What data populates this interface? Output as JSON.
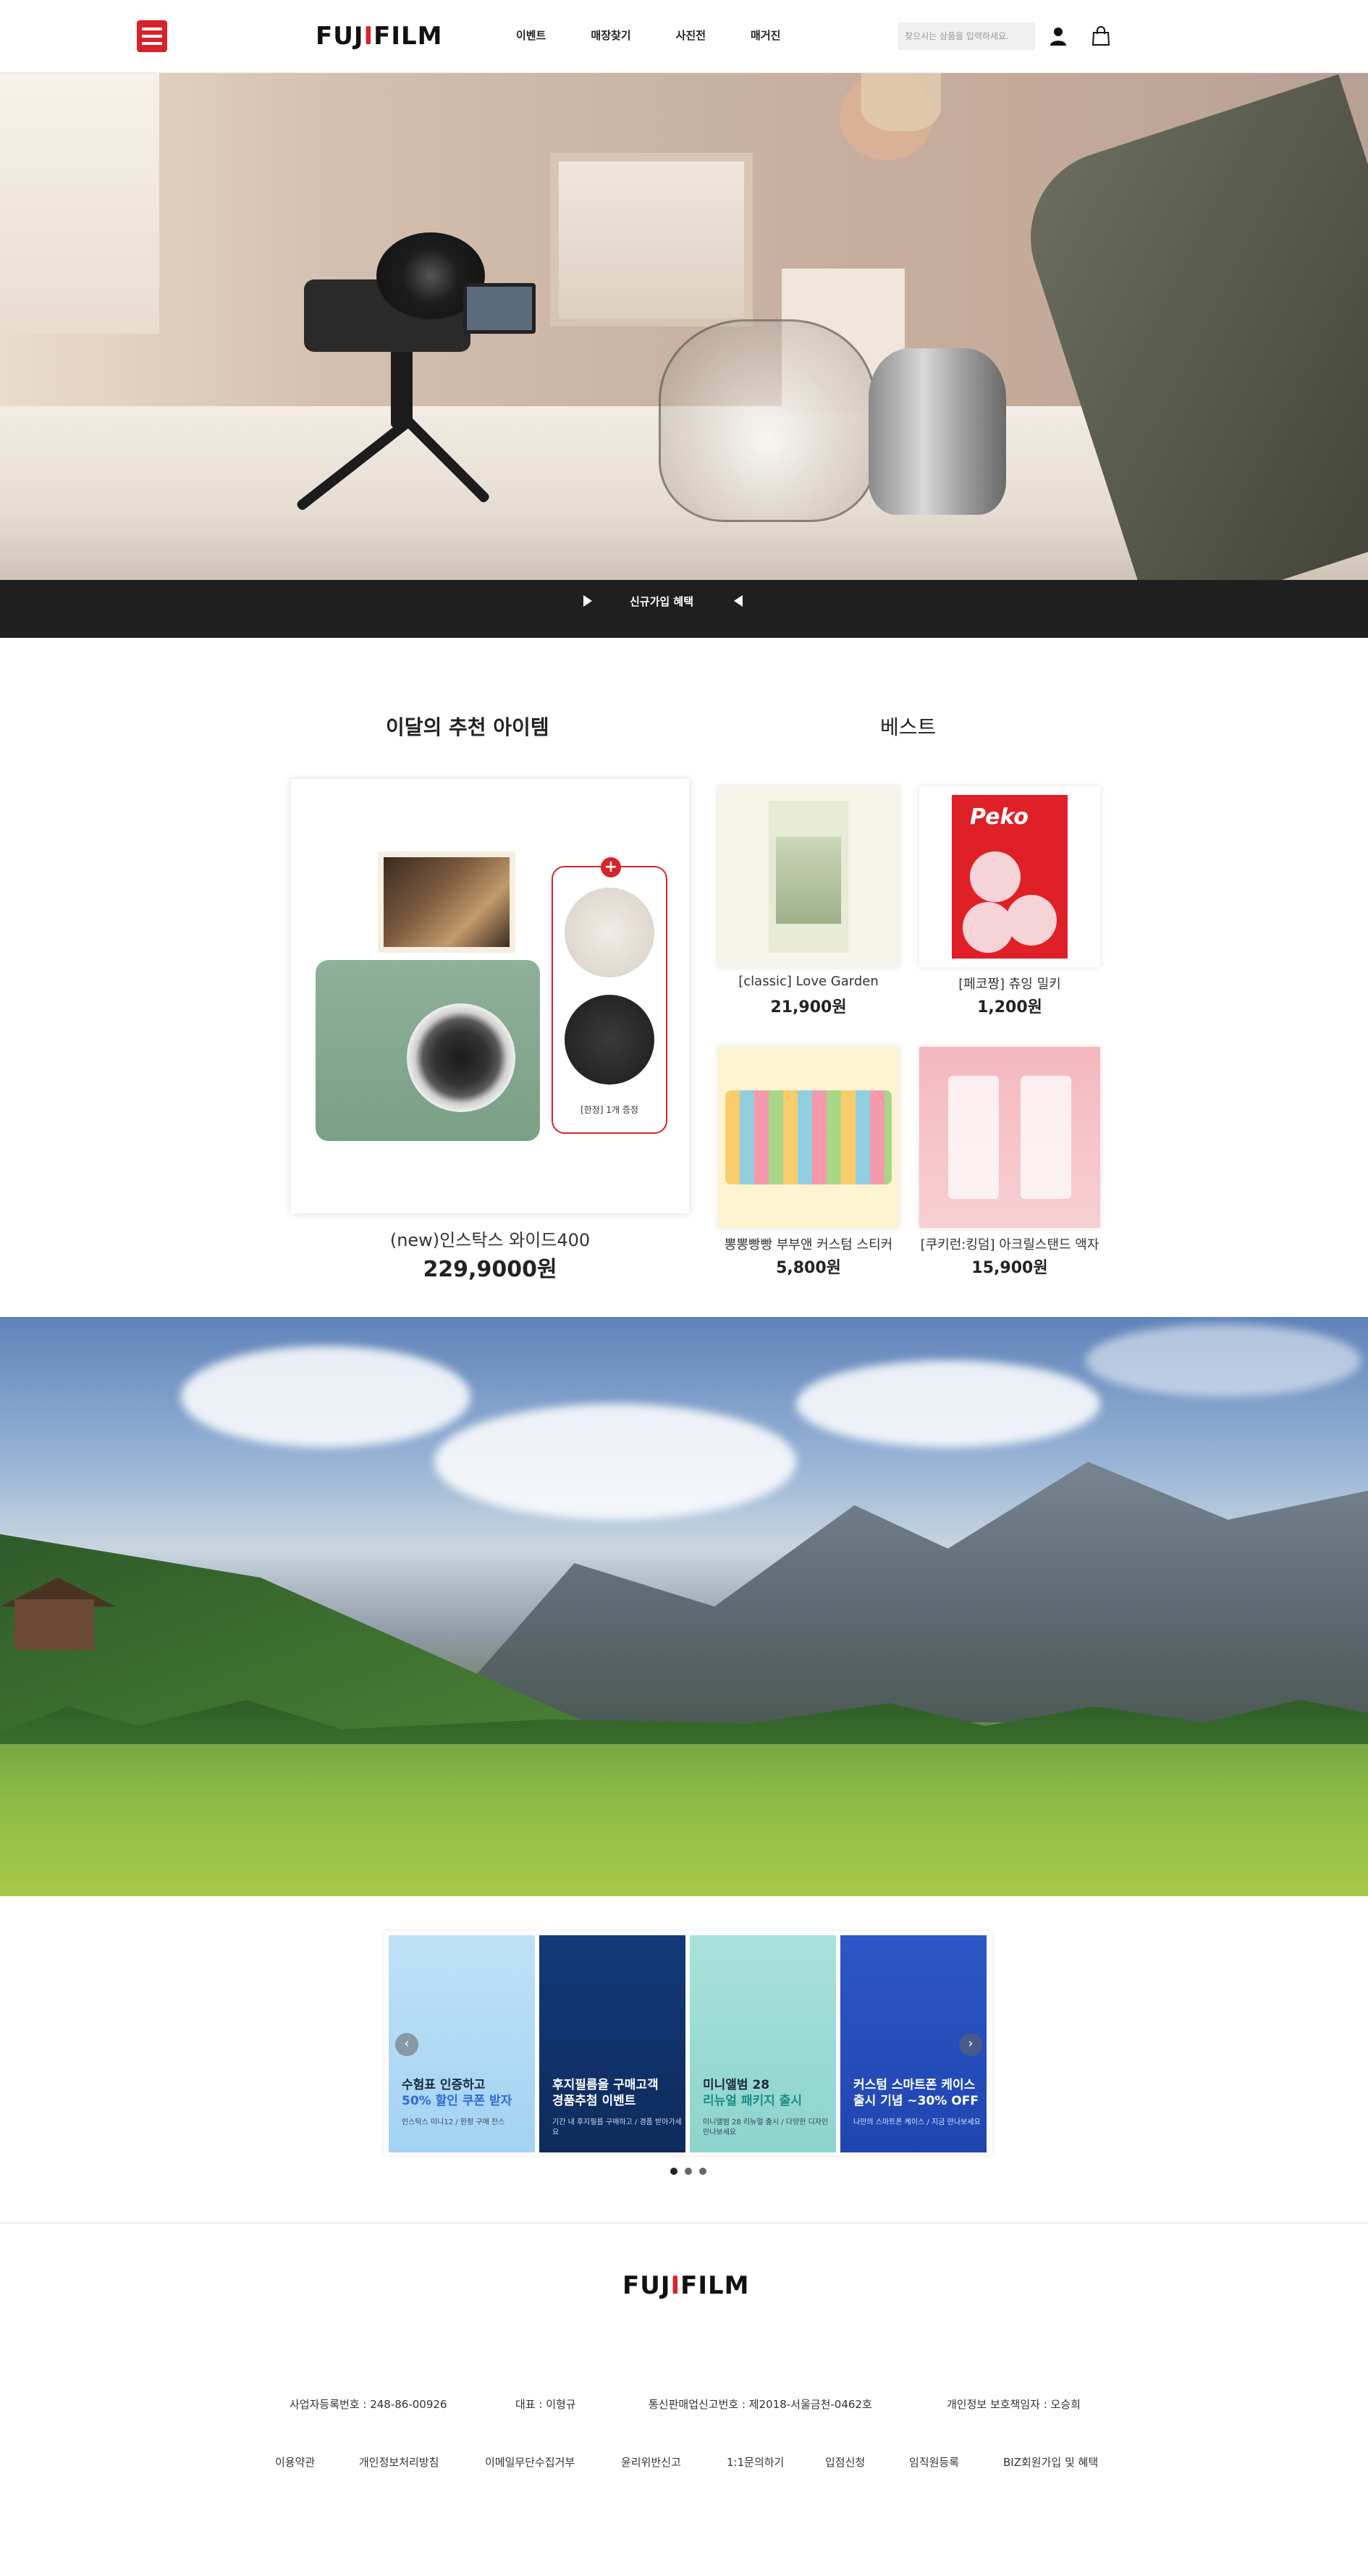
{
  "header": {
    "logo": "FUJIFILM",
    "nav": [
      "이벤트",
      "매장찾기",
      "사진전",
      "매거진"
    ],
    "search_placeholder": "찾으시는 상품을 입력하세요."
  },
  "hero": {
    "bar_label": "신규가입 혜택"
  },
  "recommend": {
    "title": "이달의 추천 아이템",
    "best_title": "베스트",
    "featured": {
      "name": "(new)인스탁스 와이드400",
      "price": "229,9000원",
      "bonus_label": "[한정] 1개 증정"
    },
    "best_items": [
      {
        "name": "[classic] Love Garden",
        "price": "21,900원"
      },
      {
        "name": "[페코짱] 츄잉 밀키",
        "price": "1,200원"
      },
      {
        "name": "뽕뽕빵빵 부부앤 커스텀 스티커",
        "price": "5,800원"
      },
      {
        "name": "[쿠키런:킹덤] 아크릴스탠드 액자",
        "price": "15,900원"
      }
    ]
  },
  "events": {
    "slides": [
      {
        "title_line1": "수험표 인증하고",
        "title_line2": "50% 할인 쿠폰 받자",
        "sub": "인스탁스 미니12 / 한정 구매 찬스"
      },
      {
        "title_line1": "후지필름을 구매고객",
        "title_line2": "경품추첨 이벤트",
        "sub": "기간 내 후지필름 구매하고 / 경품 받아가세요"
      },
      {
        "title_line1": "미니앨범 28",
        "title_line2": "리뉴얼 패키지 출시",
        "sub": "미니앨범 28 리뉴얼 출시 / 다양한 디자인 만나보세요"
      },
      {
        "title_line1": "커스텀 스마트폰 케이스",
        "title_line2": "출시 기념 ~30% OFF",
        "sub": "나만의 스마트폰 케이스 / 지금 만나보세요"
      }
    ]
  },
  "footer": {
    "logo": "FUJIFILM",
    "info": {
      "biz_no": "사업자등록번호 : 248-86-00926",
      "ceo": "대표 : 이형규",
      "mail_order": "통신판매업신고번호 : 제2018-서울금천-0462호",
      "privacy_officer": "개인정보 보호책임자 : 오승희"
    },
    "links": [
      "이용약관",
      "개인정보처리방침",
      "이메일무단수집거부",
      "윤리위반신고",
      "1:1문의하기",
      "입점신청",
      "임직원등록",
      "BIZ회원가입 및 혜택"
    ]
  }
}
